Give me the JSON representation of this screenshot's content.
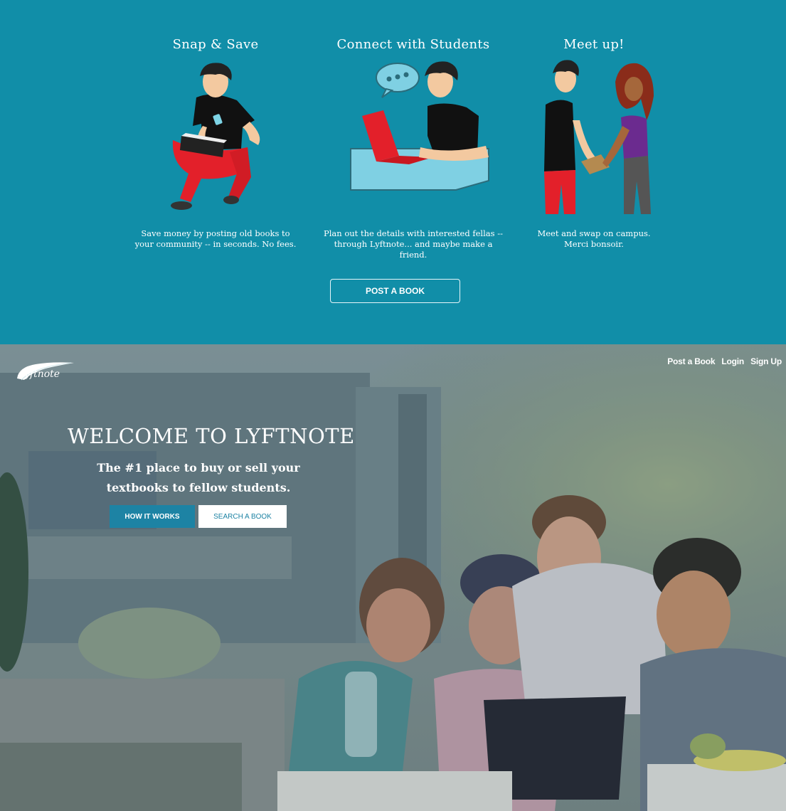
{
  "how_it_works": {
    "steps": [
      {
        "title": "Snap & Save",
        "caption_line1": "Save money by posting old books to",
        "caption_line2": "your community -- in seconds. No fees."
      },
      {
        "title": "Connect with Students",
        "caption_line1": "Plan out the details with interested fellas --",
        "caption_line2": "through Lyftnote... and maybe make a friend."
      },
      {
        "title": "Meet up!",
        "caption_line1": "Meet and swap on campus.",
        "caption_line2": "Merci bonsoir."
      }
    ],
    "post_button": "POST A BOOK",
    "accent_color": "#118ea8"
  },
  "hero": {
    "logo_text": "yftnote",
    "nav": {
      "post": "Post a Book",
      "login": "Login",
      "signup": "Sign Up"
    },
    "title": "WELCOME TO LYFTNOTE",
    "tagline": "The #1 place to buy or sell your textbooks to fellow students.",
    "buttons": {
      "how": "HOW IT WORKS",
      "search": "SEARCH A BOOK"
    },
    "button_color": "#1d83a4"
  }
}
